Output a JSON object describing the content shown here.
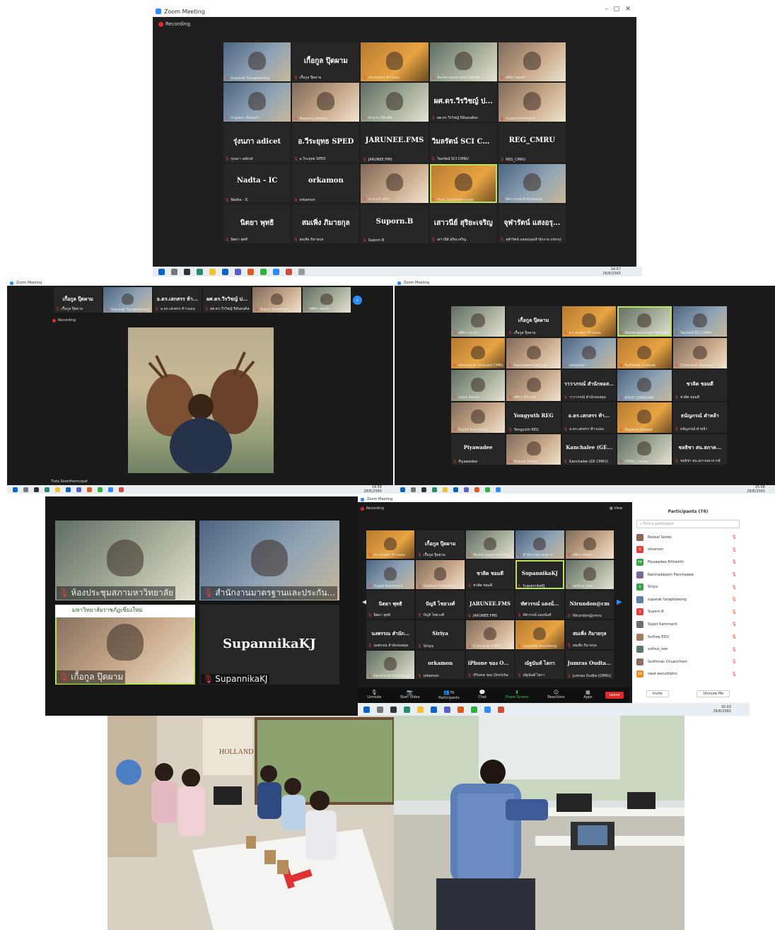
{
  "windows": {
    "w1": {
      "title": "Zoom Meeting",
      "recording": "Recording",
      "tiles": [
        {
          "center": "",
          "label": "Suparak Sarapalwong",
          "kind": "video"
        },
        {
          "center": "เกื้อกูล ปุ๊ดผาม",
          "label": "เกื้อกูล ปุ๊ดผาม",
          "kind": "name"
        },
        {
          "center": "",
          "label": "ดร.เสกสรร ท้าวแมน",
          "kind": "v2"
        },
        {
          "center": "",
          "label": "ห้องประชุมสภามหาวิทยาลัย",
          "kind": "v3"
        },
        {
          "center": "",
          "label": "ศศิธร ทองคำ",
          "kind": "v4"
        },
        {
          "center": "",
          "label": "กาญจนา เรือนแก้ว",
          "kind": "video"
        },
        {
          "center": "",
          "label": "Naparat Jiwalak",
          "kind": "v4"
        },
        {
          "center": "",
          "label": "อำนาจ เปียกพิม",
          "kind": "v3"
        },
        {
          "center": "ผศ.ดร.วีรวิชญ์ ป...",
          "label": "ผศ.ดร.วีรวิชญ์ ปิลันธนดิลก",
          "kind": "name"
        },
        {
          "center": "",
          "label": "Supot Kammanit",
          "kind": "v4"
        },
        {
          "center": "รุ่งนภา adicet",
          "label": "รุ่งนภา adicet",
          "kind": "name"
        },
        {
          "center": "อ.วีระยุทธ SPED",
          "label": "อ.วีระยุทธ SPED",
          "kind": "name"
        },
        {
          "center": "JARUNEE.FMS",
          "label": "JARUNEE.FMS",
          "kind": "name"
        },
        {
          "center": "วิมลรัตน์ SCI CM...",
          "label": "วิมลรัตน์ SCI CMRU",
          "kind": "name"
        },
        {
          "center": "REG_CMRU",
          "label": "REG_CMRU",
          "kind": "name"
        },
        {
          "center": "Nadta - IC",
          "label": "Nadta - IC",
          "kind": "name"
        },
        {
          "center": "orkamon",
          "label": "orkamon",
          "kind": "name"
        },
        {
          "center": "",
          "label": "มาลาธร์ สุริยา",
          "kind": "v4"
        },
        {
          "center": "",
          "label": "Tista Soonthornvipat",
          "kind": "v2",
          "highlight": true
        },
        {
          "center": "",
          "label": "จิตราภรณ์ สำนักหอสมุด",
          "kind": "video"
        },
        {
          "center": "นิตยา พุทธิ",
          "label": "นิตยา พุทธิ",
          "kind": "name"
        },
        {
          "center": "สมเพิ่ง ภิมายกุล",
          "label": "สมเพิ่ง ภิมายกุล",
          "kind": "name"
        },
        {
          "center": "Suporn.B",
          "label": "Suporn.B",
          "kind": "name"
        },
        {
          "center": "เสาวนีย์ สุริยะเจริญ",
          "label": "เสาวนีย์ สุริยะเจริญ",
          "kind": "name"
        },
        {
          "center": "จุฬารัตน์ แสงอรุ...",
          "label": "จุฬารัตน์ แสงอรุณ(สำนักงาน cmru)",
          "kind": "name"
        }
      ],
      "time": "14:57",
      "date": "28/6/2565"
    },
    "w2": {
      "title": "Zoom Meeting",
      "recording": "Recording",
      "strip": [
        {
          "center": "เกื้อกูล ปุ๊ดผาม",
          "label": "เกื้อกูล ปุ๊ดผาม",
          "kind": "name"
        },
        {
          "center": "",
          "label": "Suparak Sarapalwong",
          "kind": "video"
        },
        {
          "center": "อ.ดร.เสกสรร ท้า...",
          "label": "อ.ดร.เสกสรร ท้าวแมน",
          "kind": "name"
        },
        {
          "center": "ผศ.ดร.วีรวิชญ์ ป...",
          "label": "ผศ.ดร.วีรวิชญ์ ปิลันธนดิลก",
          "kind": "name"
        },
        {
          "center": "",
          "label": "Supot Kammanit",
          "kind": "v4"
        },
        {
          "center": "",
          "label": "ศศิธร ทองคำ",
          "kind": "v3"
        }
      ],
      "speaker_name": "Tista Soonthornvipat",
      "time": "14:58",
      "date": "28/6/2565"
    },
    "w3": {
      "title": "Zoom Meeting",
      "tiles": [
        {
          "center": "",
          "label": "ศศิธร ทองคำ",
          "kind": "v3"
        },
        {
          "center": "เกื้อกูล ปุ๊ดผาม",
          "label": "เกื้อกูล ปุ๊ดผาม",
          "kind": "name"
        },
        {
          "center": "",
          "label": "ดร.เสกสรร ท้าวแมน",
          "kind": "v2"
        },
        {
          "center": "",
          "label": "ห้องประชุมสภามหาวิทยาลัย",
          "kind": "v3",
          "highlight": true
        },
        {
          "center": "",
          "label": "วิมลรัตน์ SCI CMRU",
          "kind": "video"
        },
        {
          "center": "",
          "label": "Amphaino Shoiuyoi CMRU",
          "kind": "v2"
        },
        {
          "center": "",
          "label": "Kanyawee Kalasuk",
          "kind": "v4"
        },
        {
          "center": "",
          "label": "orkamon",
          "kind": "video"
        },
        {
          "center": "",
          "label": "Suthinee Chaisuk",
          "kind": "v2"
        },
        {
          "center": "",
          "label": "Chinnarat Sisuwan",
          "kind": "v4"
        },
        {
          "center": "",
          "label": "นงนุช สมเดช",
          "kind": "v3"
        },
        {
          "center": "",
          "label": "ศศิธร สุริยวงศ์",
          "kind": "v4"
        },
        {
          "center": "วาวาภรณ์ สำนักหอสมุด",
          "label": "วาวาภรณ์ สำนักหอสมุด",
          "kind": "name"
        },
        {
          "center": "",
          "label": "KOVIT JOMKHAM",
          "kind": "video"
        },
        {
          "center": "ชวลิต ชอมดี",
          "label": "ชวลิต ชอมดี",
          "kind": "name"
        },
        {
          "center": "",
          "label": "Supot Kammanit",
          "kind": "v4"
        },
        {
          "center": "Yongyuth REG",
          "label": "Yongyuth REG",
          "kind": "name"
        },
        {
          "center": "อ.ดร.เสกสรร ท้า...",
          "label": "อ.ดร.เสกสรร ท้าวแมน",
          "kind": "name"
        },
        {
          "center": "",
          "label": "Naparat Jiwalak",
          "kind": "v2"
        },
        {
          "center": "ธนัญภรณ์ คำหล้า",
          "label": "ธนัญภรณ์ คำหล้า",
          "kind": "name"
        },
        {
          "center": "Piyawadee",
          "label": "Piyawadee",
          "kind": "name"
        },
        {
          "center": "",
          "label": "Noosai Series",
          "kind": "v4"
        },
        {
          "center": "Kanchalee (GE...",
          "label": "Kanchalee (GE CMRU)",
          "kind": "name"
        },
        {
          "center": "",
          "label": "CMRU_sriwan",
          "kind": "v3"
        },
        {
          "center": "ชลธิชา สน.สภาค...",
          "label": "ชลธิชา สน.สภาคณาจารย์",
          "kind": "name"
        }
      ],
      "time": "15:06",
      "date": "28/6/2565"
    },
    "w4": {
      "tiles": [
        {
          "label": "ห้องประชุมสภามหาวิทยาลัย",
          "kind": "v3"
        },
        {
          "label": "สำนักงานมาตรฐานและประกัน...",
          "kind": "video"
        },
        {
          "label": "เกื้อกูล ปุ๊ดผาม",
          "kind": "v4",
          "highlight": true,
          "banner": "มหาวิทยาลัยราชภัฏเชียงใหม่"
        },
        {
          "label": "SupannikaKJ",
          "kind": "name",
          "center": "SupannikaKJ"
        }
      ]
    },
    "w5": {
      "title": "Zoom Meeting",
      "recording": "Recording",
      "view": "View",
      "tiles": [
        {
          "center": "",
          "label": "ดร.เสกสรร ท้าวแมน",
          "kind": "v2"
        },
        {
          "center": "เกื้อกูล ปุ๊ดผาม",
          "label": "เกื้อกูล ปุ๊ดผาม",
          "kind": "name"
        },
        {
          "center": "",
          "label": "ห้องประชุมสภามหาวิทยาลัย",
          "kind": "v3"
        },
        {
          "center": "",
          "label": "สำนักงานมาตรฐาน",
          "kind": "video"
        },
        {
          "center": "",
          "label": "ศศิธร ทองคำ",
          "kind": "v4"
        },
        {
          "center": "",
          "label": "Supot Kammanit",
          "kind": "video"
        },
        {
          "center": "",
          "label": "Sriphan Chanteng",
          "kind": "v4"
        },
        {
          "center": "ชวลิต ชอมดี",
          "label": "ชวลิต ชอมดี",
          "kind": "name"
        },
        {
          "center": "SupannikaKJ",
          "label": "SupannikaKJ",
          "kind": "name",
          "highlight": true
        },
        {
          "center": "",
          "label": "sathus_kee",
          "kind": "v3"
        },
        {
          "center": "นิตยา พุทธิ",
          "label": "นิตยา พุทธิ",
          "kind": "name"
        },
        {
          "center": "ปัญจิ ไชยวงศ์",
          "label": "ปัญจิ ไชยวงศ์",
          "kind": "name"
        },
        {
          "center": "JARUNEE.FMS",
          "label": "JARUNEE.FMS",
          "kind": "name"
        },
        {
          "center": "ทัศวรรณ์ แดงนั่...",
          "label": "ทัศวรรณ์ แดงนันท์",
          "kind": "name"
        },
        {
          "center": "Nirundon@cm",
          "label": "Nirundon@cmru",
          "kind": "name"
        },
        {
          "center": "นงพรรณ สำนัก...",
          "label": "นงพรรณ สำนักหอสมุด",
          "kind": "name"
        },
        {
          "center": "Siriya",
          "label": "Siriya",
          "kind": "name"
        },
        {
          "center": "",
          "label": "K.Jongrak CMRU",
          "kind": "v4"
        },
        {
          "center": "",
          "label": "supattra boonlerng",
          "kind": "v2"
        },
        {
          "center": "สมเพิ่ง ภิมายกุล",
          "label": "สมเพิ่ง ภิมายกุล",
          "kind": "name"
        },
        {
          "center": "",
          "label": "Kanthinee Ruengsak",
          "kind": "v3"
        },
        {
          "center": "orkamon",
          "label": "orkamon",
          "kind": "name"
        },
        {
          "center": "iPhone ของ On...",
          "label": "iPhone ของ Onnicha",
          "kind": "name"
        },
        {
          "center": "ณัฐนันท์ ไลกา",
          "label": "ณัฐนันท์ ไลกา",
          "kind": "name"
        },
        {
          "center": "Jumras Oudta (...",
          "label": "Jumras Oudta (CMRU)",
          "kind": "name"
        }
      ],
      "toolbar": [
        {
          "label": "Unmute",
          "icon": "microphone-icon"
        },
        {
          "label": "Start Video",
          "icon": "camera-icon"
        },
        {
          "label": "Participants",
          "icon": "participants-icon",
          "count": "76"
        },
        {
          "label": "Chat",
          "icon": "chat-icon"
        },
        {
          "label": "Share Screen",
          "icon": "share-screen-icon"
        },
        {
          "label": "Reactions",
          "icon": "reactions-icon"
        },
        {
          "label": "Apps",
          "icon": "apps-icon"
        },
        {
          "label": "More",
          "icon": "more-icon"
        }
      ],
      "leave": "Leave",
      "panel": {
        "title": "Participants (76)",
        "search_placeholder": "Find a participant",
        "participants": [
          {
            "name": "Noosai Series",
            "initials": "",
            "color": "#8b6b55"
          },
          {
            "name": "orkamon",
            "initials": "O",
            "color": "#e0433b"
          },
          {
            "name": "Piyawadee Rittiwirth",
            "initials": "PN",
            "color": "#3aa14a"
          },
          {
            "name": "Ratchadaporn Panchawee",
            "initials": "",
            "color": "#7a6a9c"
          },
          {
            "name": "Siriya",
            "initials": "S",
            "color": "#3aa14a"
          },
          {
            "name": "suparak tarapitawong",
            "initials": "",
            "color": "#5e7fa8"
          },
          {
            "name": "Suporn.B",
            "initials": "S",
            "color": "#e0433b"
          },
          {
            "name": "Supot Kammanit",
            "initials": "",
            "color": "#6d6d6d"
          },
          {
            "name": "Suthep EDU",
            "initials": "",
            "color": "#a07e5e"
          },
          {
            "name": "suthus_kee",
            "initials": "",
            "color": "#5c7a6a"
          },
          {
            "name": "Sutthinan Chuanchom",
            "initials": "",
            "color": "#8d6f63"
          },
          {
            "name": "swat wenuttipho",
            "initials": "SW",
            "color": "#f08c1e"
          }
        ],
        "invite": "Invite",
        "unmute_me": "Unmute Me"
      },
      "time": "15:03",
      "date": "28/6/2565"
    }
  },
  "photos": {
    "left_sign": "HOLLAND",
    "right_sign": ""
  }
}
